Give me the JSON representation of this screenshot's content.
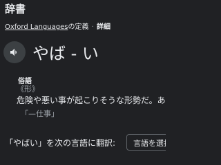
{
  "header": {
    "title": "辞書"
  },
  "source": {
    "provider": "Oxford Languages",
    "suffix": "の定義",
    "separator": "·",
    "details_link": "詳細"
  },
  "entry": {
    "headword": "やば - い",
    "speaker_icon": "speaker-icon"
  },
  "sense": {
    "pos_badge": "俗語",
    "pos": "《形》",
    "definition": "危険や悪い事が起こりそうな形勢だ。あ",
    "example": "「—仕事」"
  },
  "translate": {
    "label": "「やばい」を次の言語に翻訳:",
    "select_placeholder": "言語を選択"
  },
  "colors": {
    "background": "#202124",
    "text": "#e8eaed",
    "muted": "#9aa0a6",
    "button_bg": "#3c4043",
    "border": "#5f6368"
  }
}
